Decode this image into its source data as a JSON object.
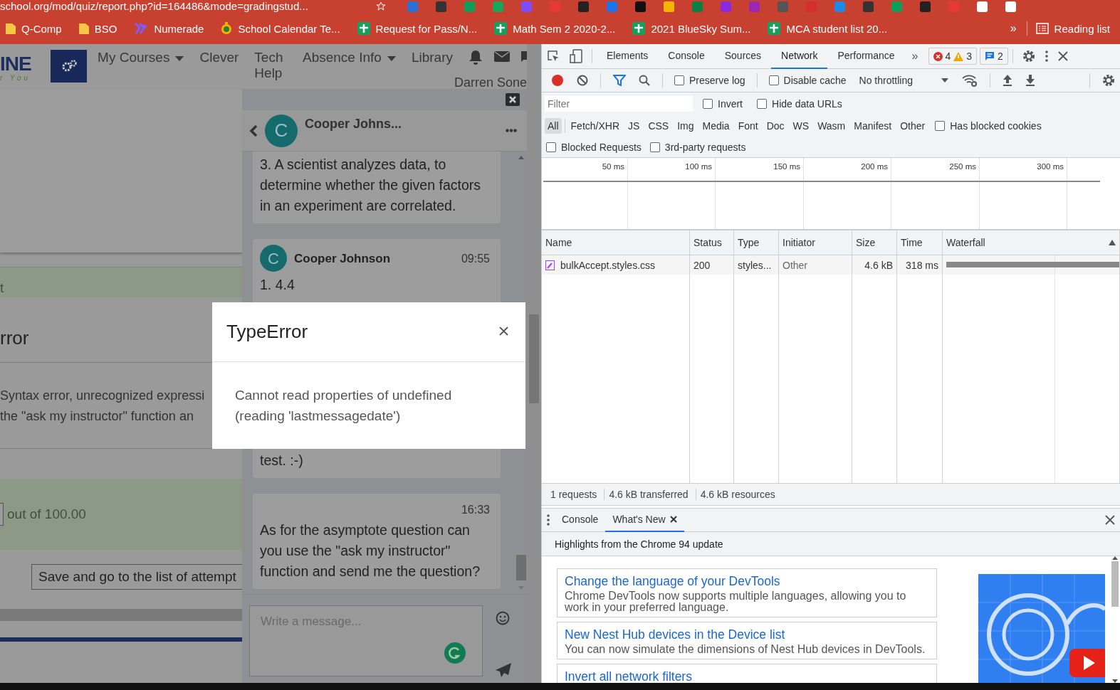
{
  "address_bar": {
    "url": "school.org/mod/quiz/report.php?id=164486&mode=gradingstud..."
  },
  "bookmarks": [
    {
      "label": "Q-Comp",
      "kind": "folder"
    },
    {
      "label": "BSO",
      "kind": "folder"
    },
    {
      "label": "Numerade",
      "kind": "numerade"
    },
    {
      "label": "School Calendar Te...",
      "kind": "calendar"
    },
    {
      "label": "Request for Pass/N...",
      "kind": "sheet"
    },
    {
      "label": "Math Sem 2 2020-2...",
      "kind": "sheet"
    },
    {
      "label": "2021 BlueSky Sum...",
      "kind": "sheet"
    },
    {
      "label": "MCA student list 20...",
      "kind": "sheet"
    }
  ],
  "bookmarks_overflow": "»",
  "reading_list": "Reading list",
  "site": {
    "logo_main": "INE",
    "logo_tagline": "r You",
    "user_name": "Darren Sone",
    "nav": [
      {
        "label": "My Courses",
        "dropdown": true
      },
      {
        "label": "Clever",
        "dropdown": false
      },
      {
        "label": "Tech Help",
        "dropdown": false
      },
      {
        "label": "Absence Info",
        "dropdown": true
      },
      {
        "label": "Library",
        "dropdown": false
      }
    ]
  },
  "page": {
    "feedback_fragment": "t",
    "error_heading": "rror",
    "error_lines": [
      "Syntax error, unrecognized expressi",
      "the \"ask my instructor\" function an"
    ],
    "grade_suffix": "out of 100.00",
    "save_button": "Save and go to the list of attempt"
  },
  "chat": {
    "contact": "Cooper Johns...",
    "avatar_letter": "C",
    "placeholder": "Write a message...",
    "messages": [
      {
        "kind": "continued",
        "text": "3. A scientist analyzes data, to determine whether the given factors in an experiment are correlated."
      },
      {
        "kind": "header",
        "sender": "Cooper Johnson",
        "avatar_letter": "C",
        "time": "09:55",
        "text": "1. 4.4"
      },
      {
        "kind": "continued",
        "text": "test. :-)"
      },
      {
        "kind": "timed",
        "time": "16:33",
        "text": "As for the asymptote question can you use the \"ask my instructor\" function and send me the question?"
      }
    ]
  },
  "modal": {
    "title": "TypeError",
    "message": "Cannot read properties of undefined (reading 'lastmessagedate')"
  },
  "devtools": {
    "tabs": [
      {
        "label": "Elements",
        "selected": false
      },
      {
        "label": "Console",
        "selected": false
      },
      {
        "label": "Sources",
        "selected": false
      },
      {
        "label": "Network",
        "selected": true
      },
      {
        "label": "Performance",
        "selected": false
      }
    ],
    "more_tabs": "»",
    "errors": "4",
    "warnings": "3",
    "messages": "2",
    "preserve_log": {
      "label": "Preserve log",
      "checked": false
    },
    "disable_cache": {
      "label": "Disable cache",
      "checked": false
    },
    "throttling": "No throttling",
    "filter_placeholder": "Filter",
    "invert": {
      "label": "Invert",
      "checked": false
    },
    "hide_data_urls": {
      "label": "Hide data URLs",
      "checked": false
    },
    "types": [
      {
        "label": "All",
        "selected": true
      },
      {
        "label": "Fetch/XHR",
        "selected": false
      },
      {
        "label": "JS",
        "selected": false
      },
      {
        "label": "CSS",
        "selected": false
      },
      {
        "label": "Img",
        "selected": false
      },
      {
        "label": "Media",
        "selected": false
      },
      {
        "label": "Font",
        "selected": false
      },
      {
        "label": "Doc",
        "selected": false
      },
      {
        "label": "WS",
        "selected": false
      },
      {
        "label": "Wasm",
        "selected": false
      },
      {
        "label": "Manifest",
        "selected": false
      },
      {
        "label": "Other",
        "selected": false
      }
    ],
    "has_blocked_cookies": {
      "label": "Has blocked cookies",
      "checked": false
    },
    "blocked_requests": {
      "label": "Blocked Requests",
      "checked": false
    },
    "third_party": {
      "label": "3rd-party requests",
      "checked": false
    },
    "timeline_ticks": [
      "50 ms",
      "100 ms",
      "150 ms",
      "200 ms",
      "250 ms",
      "300 ms"
    ],
    "table": {
      "columns": [
        "Name",
        "Status",
        "Type",
        "Initiator",
        "Size",
        "Time",
        "Waterfall"
      ],
      "rows": [
        {
          "name": "bulkAccept.styles.css",
          "status": "200",
          "type": "styles...",
          "initiator": "Other",
          "size": "4.6 kB",
          "time": "318 ms"
        }
      ]
    },
    "summary": [
      "1 requests",
      "4.6 kB transferred",
      "4.6 kB resources"
    ],
    "drawer_tabs": [
      {
        "label": "Console",
        "selected": false,
        "closable": false
      },
      {
        "label": "What's New",
        "selected": true,
        "closable": true
      }
    ],
    "highlights": "Highlights from the Chrome 94 update",
    "cards": [
      {
        "title": "Change the language of your DevTools",
        "description": "Chrome DevTools now supports multiple languages, allowing you to work in your preferred language."
      },
      {
        "title": "New Nest Hub devices in the Device list",
        "description": "You can now simulate the dimensions of Nest Hub devices in DevTools."
      },
      {
        "title": "Invert all network filters"
      }
    ]
  }
}
